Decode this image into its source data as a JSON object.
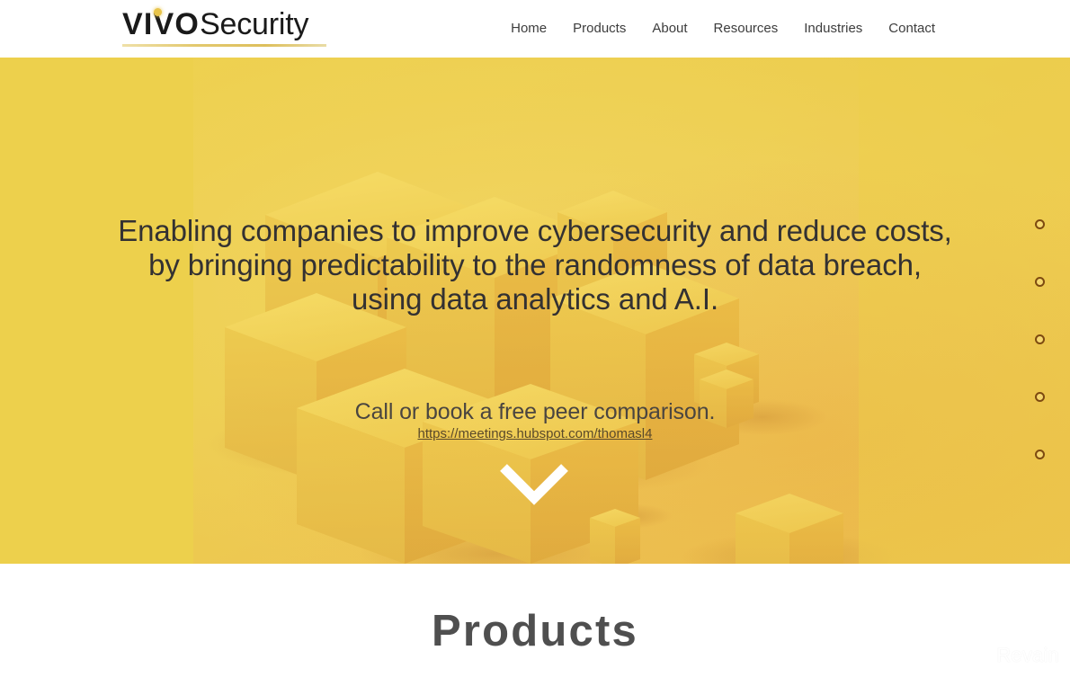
{
  "header": {
    "logo": {
      "brand_bold": "VIVO",
      "brand_light": "Security",
      "dot_color": "#e8c44a",
      "underline_color": "#ddbf5c"
    },
    "nav": [
      {
        "label": "Home"
      },
      {
        "label": "Products"
      },
      {
        "label": "About"
      },
      {
        "label": "Resources"
      },
      {
        "label": "Industries"
      },
      {
        "label": "Contact"
      }
    ]
  },
  "hero": {
    "background_color": "#edd04c",
    "headline_line1": "Enabling companies to improve cybersecurity and reduce costs,",
    "headline_line2": "by bringing predictability to the randomness of data breach,",
    "headline_line3": "using data analytics and A.I.",
    "subtext": "Call or book a free peer comparison.",
    "link_text": "https://meetings.hubspot.com/thomasl4",
    "scroll_indicator": "chevron-down",
    "dot_nav": [
      {
        "index": "1"
      },
      {
        "index": "2"
      },
      {
        "index": "3"
      },
      {
        "index": "4"
      },
      {
        "index": "5"
      }
    ],
    "dot_color": "#7d4a10"
  },
  "products": {
    "title": "Products"
  },
  "watermark": {
    "text": "Revain"
  }
}
